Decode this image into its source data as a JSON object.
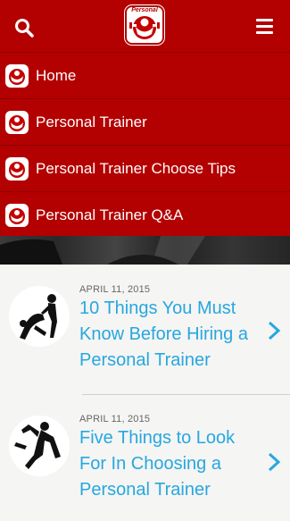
{
  "header": {
    "logo_text": "Personal",
    "search_icon": "search-icon",
    "menu_icon": "hamburger-menu-icon",
    "brand_color": "#b30000"
  },
  "nav": {
    "items": [
      {
        "label": "Home"
      },
      {
        "label": "Personal Trainer"
      },
      {
        "label": "Personal Trainer Choose Tips"
      },
      {
        "label": "Personal Trainer Q&A"
      }
    ]
  },
  "posts": [
    {
      "date": "APRIL 11, 2015",
      "title": "10 Things You Must Know Before Hiring a Personal Trainer"
    },
    {
      "date": "APRIL 11, 2015",
      "title": "Five Things to Look For In Choosing a Personal Trainer"
    }
  ],
  "colors": {
    "link": "#27a7e0",
    "background": "#f5f5f3"
  }
}
